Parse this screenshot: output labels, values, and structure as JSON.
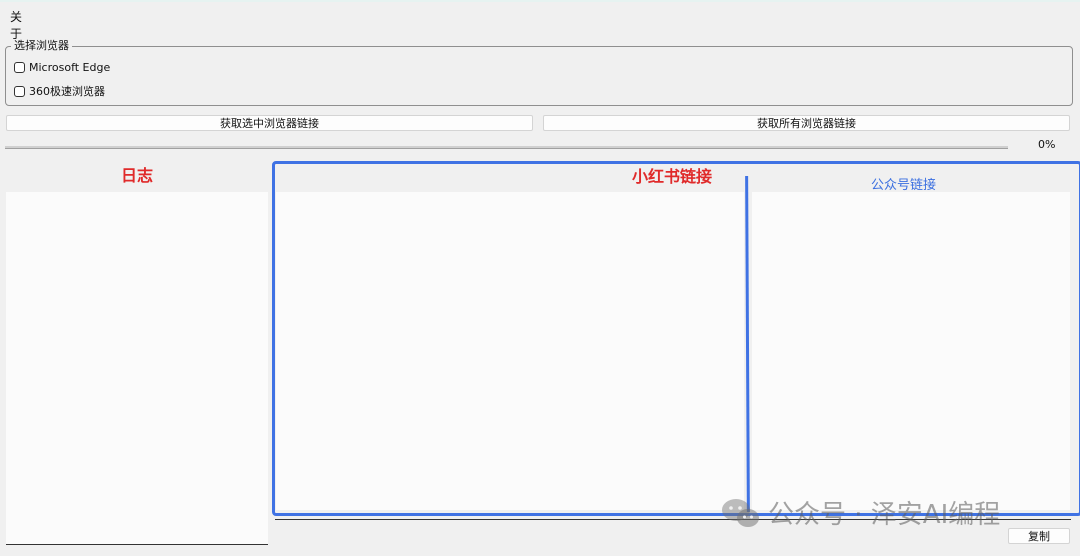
{
  "menu": {
    "about": "关于"
  },
  "browser_group": {
    "title": "选择浏览器",
    "options": [
      {
        "label": "Microsoft Edge",
        "checked": false
      },
      {
        "label": "360极速浏览器",
        "checked": false
      }
    ]
  },
  "buttons": {
    "get_selected": "获取选中浏览器链接",
    "get_all": "获取所有浏览器链接",
    "copy": "复制"
  },
  "progress": {
    "value": 0,
    "text": "0%"
  },
  "panels": {
    "log_label": "日志",
    "xhs_label": "小红书链接",
    "gzh_label": "公众号链接"
  },
  "watermark": {
    "text": "公众号 · 泽安AI编程"
  },
  "colors": {
    "annotation_red": "#e02a2a",
    "annotation_blue": "#3f72e4",
    "progress_fill": "#06b025"
  }
}
